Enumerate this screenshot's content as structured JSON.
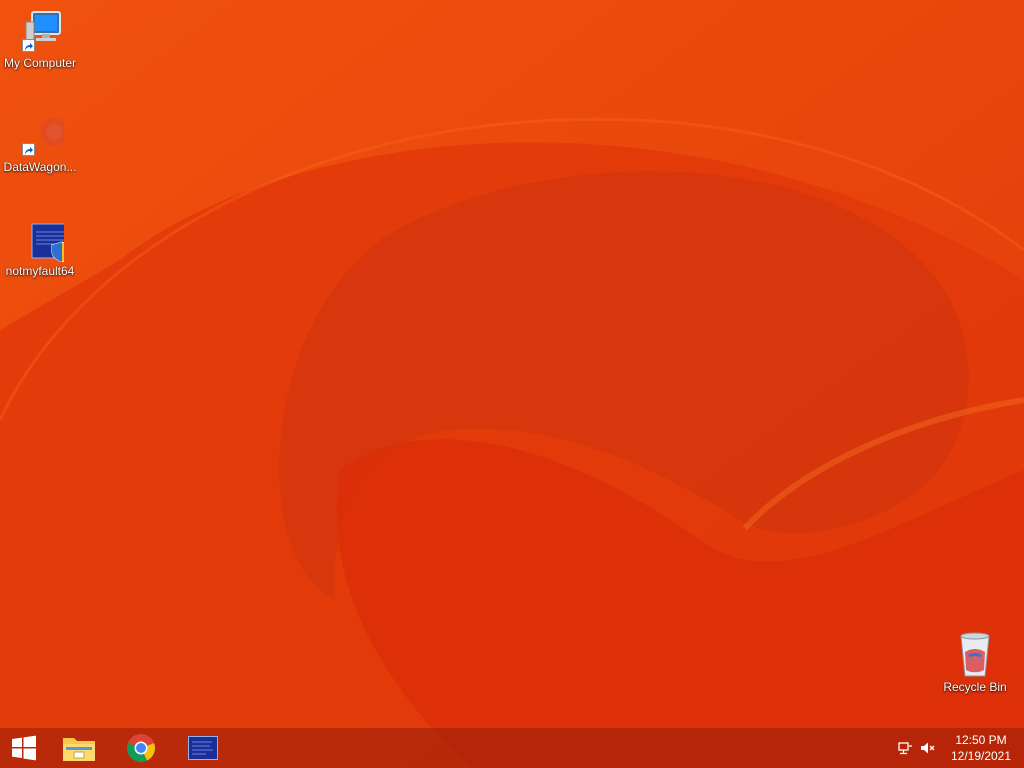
{
  "desktop": {
    "background_color": "#e8400a",
    "icons": [
      {
        "label": "My Computer",
        "icon": "computer-icon"
      },
      {
        "label": "DataWagon...",
        "icon": "datawagon-icon"
      },
      {
        "label": "notmyfault64",
        "icon": "notmyfault-icon"
      },
      {
        "label": "Recycle Bin",
        "icon": "recycle-bin-icon"
      }
    ]
  },
  "taskbar": {
    "start_icon": "windows-logo-icon",
    "pinned": [
      {
        "icon": "file-explorer-icon"
      },
      {
        "icon": "chrome-icon"
      },
      {
        "icon": "notmyfault-app-icon"
      }
    ],
    "tray": {
      "icons": [
        "network-icon",
        "speaker-muted-icon"
      ],
      "time": "12:50 PM",
      "date": "12/19/2021"
    }
  }
}
